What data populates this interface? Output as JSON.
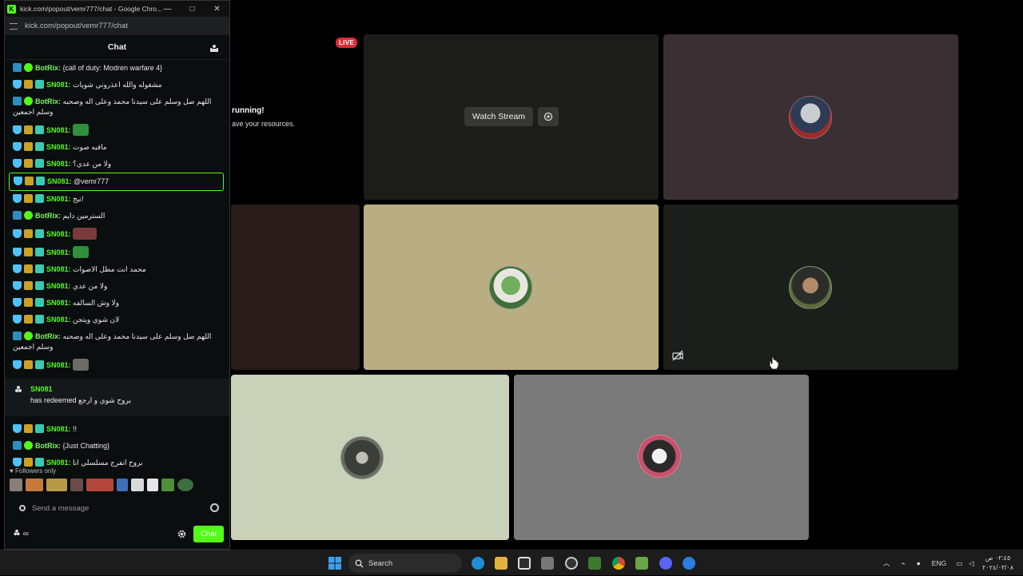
{
  "stream": {
    "live_badge": "LIVE",
    "running_title": "running!",
    "running_sub": "ave your resources.",
    "watch_button": "Watch Stream"
  },
  "window": {
    "title": "kick.com/popout/vemr777/chat - Google Chro...",
    "url": "kick.com/popout/vemr777/chat",
    "controls": [
      "—",
      "□",
      "✕"
    ]
  },
  "chat": {
    "header": "Chat",
    "messages": [
      {
        "user": "BotRix:",
        "text": "{call of duty: Modren warfare 4}"
      },
      {
        "user": "SN081:",
        "text": "مشغوله والله اعذروني شويات"
      },
      {
        "user": "BotRix:",
        "text": "اللهم صل وسلم على سيدنا محمد وعلى اله وصحبه وسلم اجمعين"
      },
      {
        "user": "SN081:",
        "text": ""
      },
      {
        "user": "SN081:",
        "text": "مافيه صوت"
      },
      {
        "user": "SN081:",
        "text": "ولا من عدي؟"
      },
      {
        "user": "SN081:",
        "text": "@vemr777"
      },
      {
        "user": "SN081:",
        "text": "تيج!"
      },
      {
        "user": "BotRix:",
        "text": "السترمين دايم"
      },
      {
        "user": "SN081:",
        "text": ""
      },
      {
        "user": "SN081:",
        "text": ""
      },
      {
        "user": "SN081:",
        "text": "محمد انت مطل الاصوات"
      },
      {
        "user": "SN081:",
        "text": "ولا من عدي"
      },
      {
        "user": "SN081:",
        "text": "ولا وش السالفه"
      },
      {
        "user": "SN081:",
        "text": "لان شوي ويتجن"
      },
      {
        "user": "BotRix:",
        "text": "اللهم صل وسلم على سيدنا محمد وعلى اله وصحبه وسلم اجمعين"
      },
      {
        "user": "SN081:",
        "text": ""
      }
    ],
    "redeem": {
      "user": "SN081",
      "text": "has redeemed بروح شوي و ارجع"
    },
    "messages_after": [
      {
        "user": "SN081:",
        "text": "!!"
      },
      {
        "user": "BotRix:",
        "text": "{Just Chatting}"
      },
      {
        "user": "SN081:",
        "text": "بروح انفرج مسلسلي انا"
      }
    ],
    "followers_only": "Followers only",
    "input_placeholder": "Send a message",
    "points": "∞",
    "send_button": "Chat"
  },
  "taskbar": {
    "search_label": "Search",
    "language": "ENG",
    "time": "٠٢:٤٥ ص",
    "date": "٢٠٢٤/٠٣/٠٨"
  },
  "colors": {
    "accent": "#53fc18",
    "tile_video": "#1c1c1a",
    "tile_top_right": "#3a3033",
    "tile_mid_left": "#2a1c1a",
    "tile_mid_center": "#b9ad84",
    "tile_mid_right": "#1b1f1b",
    "tile_bottom_left": "#c9d2b9",
    "tile_bottom_right": "#7a7a7a"
  }
}
